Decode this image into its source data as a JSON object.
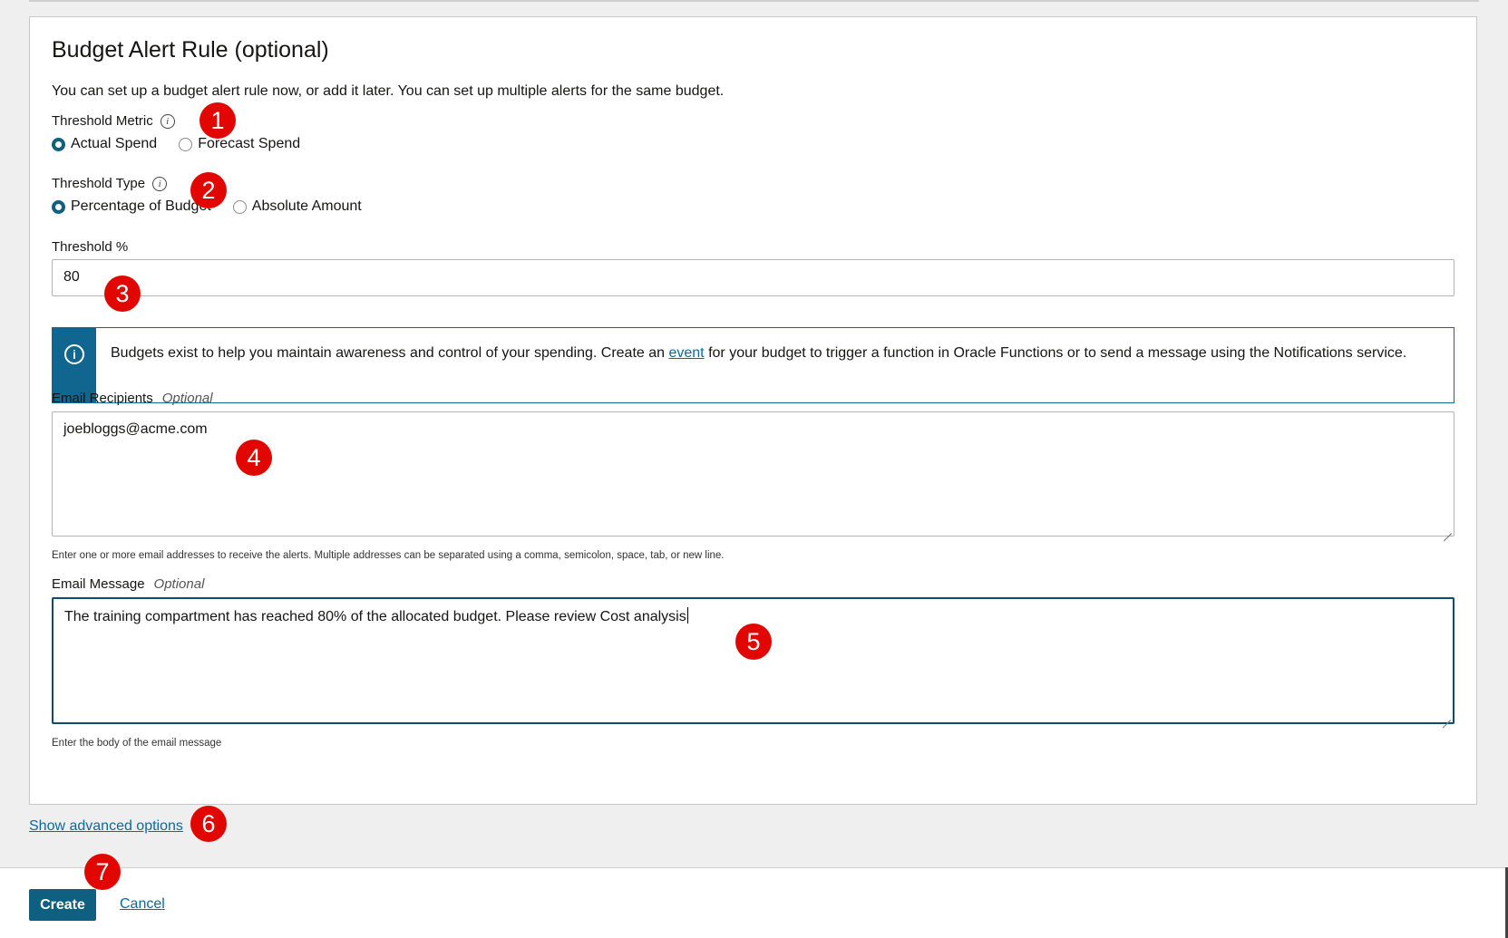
{
  "section": {
    "title": "Budget Alert Rule (optional)",
    "description": "You can set up a budget alert rule now, or add it later. You can set up multiple alerts for the same budget."
  },
  "threshold_metric": {
    "label": "Threshold Metric",
    "options": [
      "Actual Spend",
      "Forecast Spend"
    ],
    "selected": "Actual Spend"
  },
  "threshold_type": {
    "label": "Threshold Type",
    "options": [
      "Percentage of Budget",
      "Absolute Amount"
    ],
    "selected": "Percentage of Budget"
  },
  "threshold_percent": {
    "label": "Threshold %",
    "value": "80"
  },
  "info_banner": {
    "text_before": "Budgets exist to help you maintain awareness and control of your spending. Create an ",
    "link": "event",
    "text_after": " for your budget to trigger a function in Oracle Functions or to send a message using the Notifications service."
  },
  "email_recipients": {
    "label": "Email Recipients",
    "optional": "Optional",
    "value": "joebloggs@acme.com",
    "helper": "Enter one or more email addresses to receive the alerts. Multiple addresses can be separated using a comma, semicolon, space, tab, or new line."
  },
  "email_message": {
    "label": "Email Message",
    "optional": "Optional",
    "value": "The training compartment has reached 80% of the allocated budget. Please review Cost analysis",
    "helper": "Enter the body of the email message"
  },
  "advanced_link": "Show advanced options",
  "footer": {
    "create": "Create",
    "cancel": "Cancel"
  },
  "markers": [
    "1",
    "2",
    "3",
    "4",
    "5",
    "6",
    "7"
  ],
  "colors": {
    "primary": "#0f5f80",
    "link": "#0b6a9e",
    "marker": "#e10600"
  }
}
